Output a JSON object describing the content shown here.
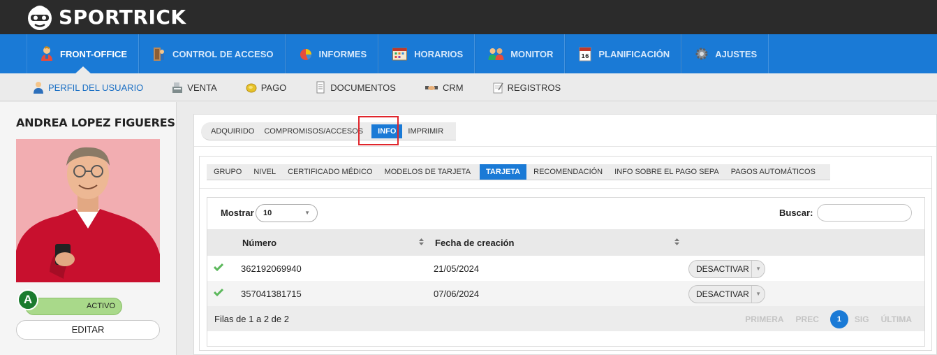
{
  "brand": {
    "name": "SPORTRICK"
  },
  "main_nav": [
    {
      "label": "FRONT-OFFICE",
      "icon": "user-icon",
      "active": true
    },
    {
      "label": "CONTROL DE ACCESO",
      "icon": "door-icon"
    },
    {
      "label": "INFORMES",
      "icon": "pie-chart-icon"
    },
    {
      "label": "HORARIOS",
      "icon": "calendar-icon"
    },
    {
      "label": "MONITOR",
      "icon": "people-icon"
    },
    {
      "label": "PLANIFICACIÓN",
      "icon": "calendar-page-icon"
    },
    {
      "label": "AJUSTES",
      "icon": "gear-icon"
    }
  ],
  "sub_nav": [
    {
      "label": "PERFIL DEL USUARIO",
      "icon": "user-icon",
      "active": true
    },
    {
      "label": "VENTA",
      "icon": "cash-register-icon"
    },
    {
      "label": "PAGO",
      "icon": "coin-icon"
    },
    {
      "label": "DOCUMENTOS",
      "icon": "document-icon"
    },
    {
      "label": "CRM",
      "icon": "handshake-icon"
    },
    {
      "label": "REGISTROS",
      "icon": "notepad-icon"
    }
  ],
  "user": {
    "name": "ANDREA LOPEZ FIGUERES",
    "status_letter": "A",
    "status_label": "ACTIVO",
    "edit_label": "EDITAR"
  },
  "tabs_level1": [
    {
      "label": "ADQUIRIDO"
    },
    {
      "label": "COMPROMISOS/ACCESOS"
    },
    {
      "label": "INFO",
      "active": true
    },
    {
      "label": "IMPRIMIR"
    }
  ],
  "tabs_level2": [
    {
      "label": "GRUPO"
    },
    {
      "label": "NIVEL"
    },
    {
      "label": "CERTIFICADO MÉDICO"
    },
    {
      "label": "MODELOS DE TARJETA"
    },
    {
      "label": "TARJETA",
      "active": true
    },
    {
      "label": "RECOMENDACIÓN"
    },
    {
      "label": "INFO SOBRE EL PAGO SEPA"
    },
    {
      "label": "PAGOS AUTOMÁTICOS"
    }
  ],
  "table": {
    "show_label": "Mostrar",
    "show_value": "10",
    "search_label": "Buscar:",
    "search_value": "",
    "columns": [
      "Número",
      "Fecha de creación"
    ],
    "rows": [
      {
        "numero": "362192069940",
        "fecha": "21/05/2024",
        "action": "DESACTIVAR"
      },
      {
        "numero": "357041381715",
        "fecha": "07/06/2024",
        "action": "DESACTIVAR"
      }
    ],
    "rows_info": "Filas de 1 a 2 de 2",
    "pager": {
      "first": "PRIMERA",
      "prev": "PREC",
      "current": "1",
      "next": "SIG",
      "last": "ÚLTIMA"
    }
  },
  "colors": {
    "nav_blue": "#1a7ad6",
    "topbar": "#2b2b2b",
    "active_green": "#1b7b2f",
    "highlight_red": "#e0252b"
  }
}
